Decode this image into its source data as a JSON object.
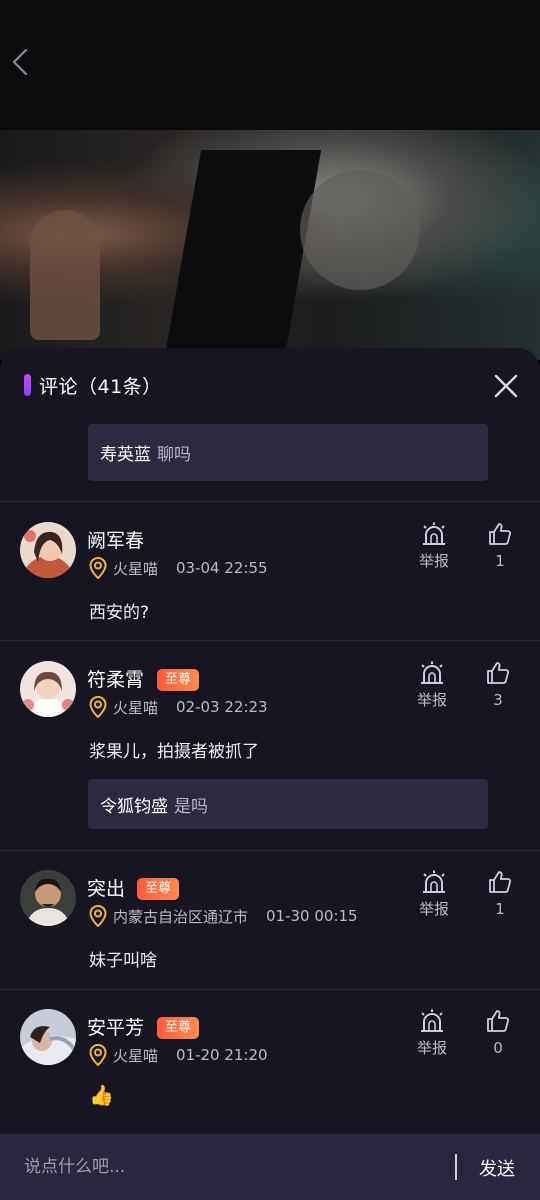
{
  "colors": {
    "accent": "#a845ff",
    "badge": "#ff6a40",
    "pin": "#f2b531",
    "sheet_bg": "#181622",
    "reply_bg": "#2d2940"
  },
  "sheet": {
    "title": "评论（41条）"
  },
  "top_reply": {
    "name": "寿英蓝",
    "text": "聊吗"
  },
  "comments": [
    {
      "name": "阙军春",
      "badge": "",
      "location": "火星喵",
      "time": "03-04 22:55",
      "text": "西安的?",
      "report_label": "举报",
      "likes": "1"
    },
    {
      "name": "符柔霄",
      "badge": "至尊",
      "location": "火星喵",
      "time": "02-03 22:23",
      "text": "浆果儿，拍摄者被抓了",
      "report_label": "举报",
      "likes": "3",
      "reply": {
        "name": "令狐钧盛",
        "text": "是吗"
      }
    },
    {
      "name": "突出",
      "badge": "至尊",
      "location": "内蒙古自治区通辽市",
      "time": "01-30 00:15",
      "text": "妹子叫啥",
      "report_label": "举报",
      "likes": "1"
    },
    {
      "name": "安平芳",
      "badge": "至尊",
      "location": "火星喵",
      "time": "01-20 21:20",
      "text": "👍",
      "report_label": "举报",
      "likes": "0"
    }
  ],
  "input": {
    "placeholder": "说点什么吧...",
    "send_label": "发送"
  }
}
